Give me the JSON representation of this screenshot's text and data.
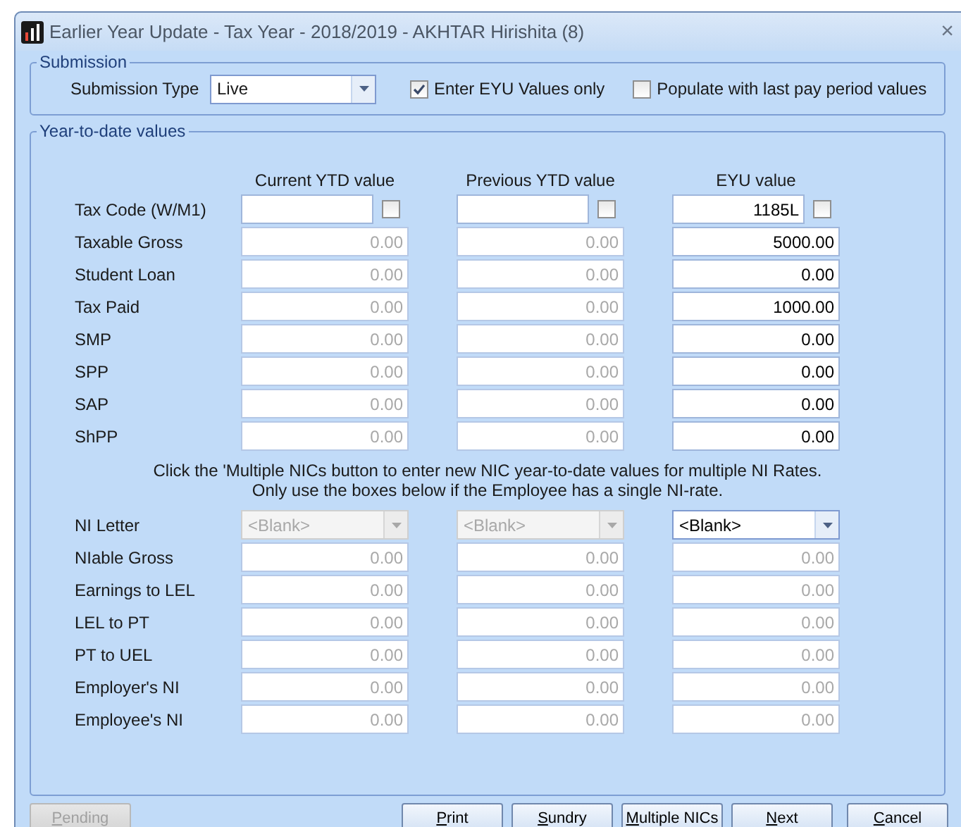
{
  "window": {
    "title": "Earlier Year Update - Tax Year - 2018/2019 - AKHTAR Hirishita (8)",
    "close": "×"
  },
  "submission": {
    "legend": "Submission",
    "type_label": "Submission Type",
    "type_value": "Live",
    "checks": [
      {
        "label": "Enter EYU Values only",
        "checked": true
      },
      {
        "label": "Populate with last pay period values",
        "checked": false
      }
    ]
  },
  "ytd": {
    "legend": "Year-to-date values",
    "columns": [
      "Current YTD value",
      "Previous YTD value",
      "EYU value"
    ],
    "rows": [
      {
        "kind": "code",
        "label": "Tax Code (W/M1)",
        "cells": [
          {
            "checked": false
          },
          {
            "checked": false
          },
          {
            "value": "1185L",
            "checked": false
          }
        ]
      },
      {
        "kind": "text",
        "label": "Taxable Gross",
        "cells": [
          {
            "value": "0.00",
            "disabled": true
          },
          {
            "value": "0.00",
            "disabled": true
          },
          {
            "value": "5000.00",
            "disabled": false
          }
        ]
      },
      {
        "kind": "text",
        "label": "Student Loan",
        "cells": [
          {
            "value": "0.00",
            "disabled": true
          },
          {
            "value": "0.00",
            "disabled": true
          },
          {
            "value": "0.00",
            "disabled": false
          }
        ]
      },
      {
        "kind": "text",
        "label": "Tax Paid",
        "cells": [
          {
            "value": "0.00",
            "disabled": true
          },
          {
            "value": "0.00",
            "disabled": true
          },
          {
            "value": "1000.00",
            "disabled": false
          }
        ]
      },
      {
        "kind": "text",
        "label": "SMP",
        "cells": [
          {
            "value": "0.00",
            "disabled": true
          },
          {
            "value": "0.00",
            "disabled": true
          },
          {
            "value": "0.00",
            "disabled": false
          }
        ]
      },
      {
        "kind": "text",
        "label": "SPP",
        "cells": [
          {
            "value": "0.00",
            "disabled": true
          },
          {
            "value": "0.00",
            "disabled": true
          },
          {
            "value": "0.00",
            "disabled": false
          }
        ]
      },
      {
        "kind": "text",
        "label": "SAP",
        "cells": [
          {
            "value": "0.00",
            "disabled": true
          },
          {
            "value": "0.00",
            "disabled": true
          },
          {
            "value": "0.00",
            "disabled": false
          }
        ]
      },
      {
        "kind": "text",
        "label": "ShPP",
        "cells": [
          {
            "value": "0.00",
            "disabled": true
          },
          {
            "value": "0.00",
            "disabled": true
          },
          {
            "value": "0.00",
            "disabled": false
          }
        ]
      }
    ],
    "note": [
      "Click the 'Multiple NICs button to enter new NIC year-to-date values for multiple NI Rates.",
      "Only use the boxes below if the Employee has a single NI-rate."
    ],
    "ni_rows": [
      {
        "kind": "select",
        "label": "NI Letter",
        "cells": [
          {
            "value": "<Blank>",
            "disabled": true
          },
          {
            "value": "<Blank>",
            "disabled": true
          },
          {
            "value": "<Blank>",
            "disabled": false
          }
        ]
      },
      {
        "kind": "text",
        "label": "NIable Gross",
        "cells": [
          {
            "value": "0.00",
            "disabled": true
          },
          {
            "value": "0.00",
            "disabled": true
          },
          {
            "value": "0.00",
            "disabled": true
          }
        ]
      },
      {
        "kind": "text",
        "label": "Earnings to LEL",
        "cells": [
          {
            "value": "0.00",
            "disabled": true
          },
          {
            "value": "0.00",
            "disabled": true
          },
          {
            "value": "0.00",
            "disabled": true
          }
        ]
      },
      {
        "kind": "text",
        "label": "LEL to PT",
        "cells": [
          {
            "value": "0.00",
            "disabled": true
          },
          {
            "value": "0.00",
            "disabled": true
          },
          {
            "value": "0.00",
            "disabled": true
          }
        ]
      },
      {
        "kind": "text",
        "label": "PT to UEL",
        "cells": [
          {
            "value": "0.00",
            "disabled": true
          },
          {
            "value": "0.00",
            "disabled": true
          },
          {
            "value": "0.00",
            "disabled": true
          }
        ]
      },
      {
        "kind": "text",
        "label": "Employer's NI",
        "cells": [
          {
            "value": "0.00",
            "disabled": true
          },
          {
            "value": "0.00",
            "disabled": true
          },
          {
            "value": "0.00",
            "disabled": true
          }
        ]
      },
      {
        "kind": "text",
        "label": "Employee's NI",
        "cells": [
          {
            "value": "0.00",
            "disabled": true
          },
          {
            "value": "0.00",
            "disabled": true
          },
          {
            "value": "0.00",
            "disabled": true
          }
        ]
      }
    ]
  },
  "buttons": [
    {
      "label": "Pending",
      "disabled": true
    },
    {
      "label": "Print",
      "disabled": false
    },
    {
      "label": "Sundry",
      "disabled": false
    },
    {
      "label": "Multiple NICs",
      "disabled": false
    },
    {
      "label": "Next",
      "disabled": false
    },
    {
      "label": "Cancel",
      "disabled": false
    }
  ]
}
